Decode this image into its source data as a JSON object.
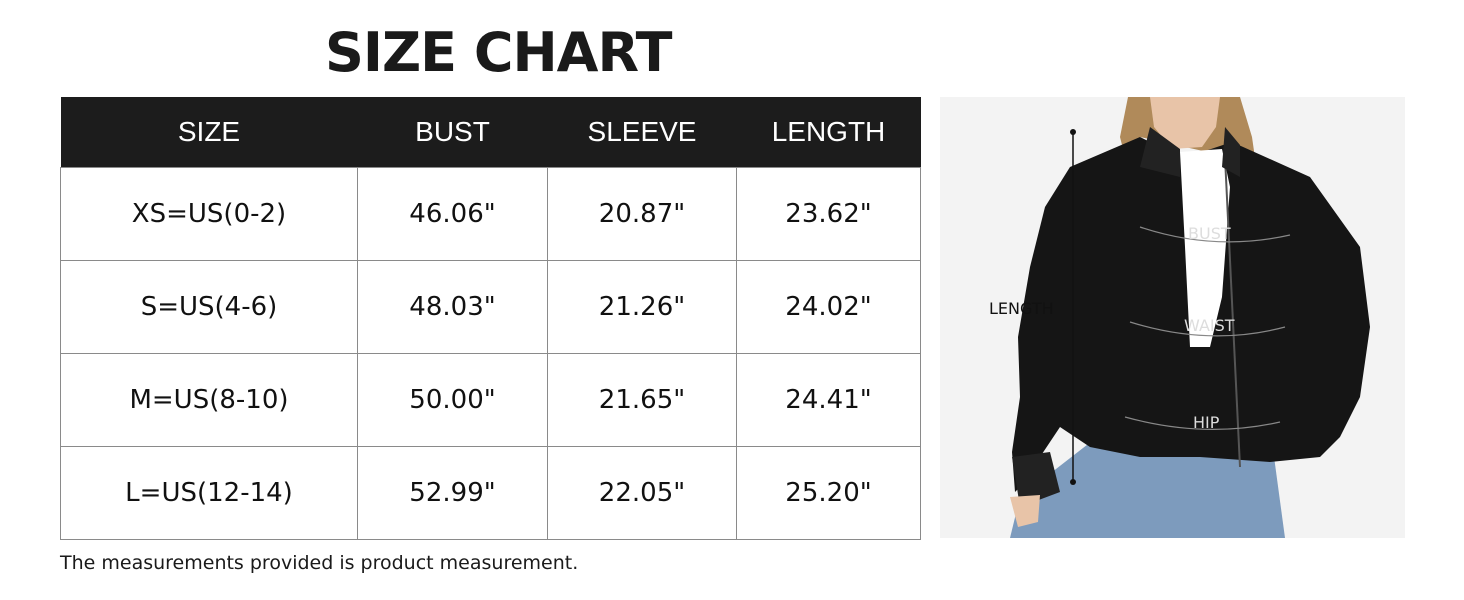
{
  "title": "SIZE CHART",
  "table": {
    "headers": [
      "SIZE",
      "BUST",
      "SLEEVE",
      "LENGTH"
    ],
    "rows": [
      [
        "XS=US(0-2)",
        "46.06\"",
        "20.87\"",
        "23.62\""
      ],
      [
        "S=US(4-6)",
        "48.03\"",
        "21.26\"",
        "24.02\""
      ],
      [
        "M=US(8-10)",
        "50.00\"",
        "21.65\"",
        "24.41\""
      ],
      [
        "L=US(12-14)",
        "52.99\"",
        "22.05\"",
        "25.20\""
      ]
    ]
  },
  "note": "The measurements provided is product measurement.",
  "diagram": {
    "labels": {
      "length": "LENGTH",
      "bust": "BUST",
      "waist": "WAIST",
      "hip": "HIP"
    },
    "colors": {
      "jacket": "#151515",
      "jeans": "#7d9bbd",
      "shirt": "#ffffff",
      "hair": "#b08a5a",
      "skin": "#e8c4a8",
      "background": "#f3f3f3"
    }
  }
}
